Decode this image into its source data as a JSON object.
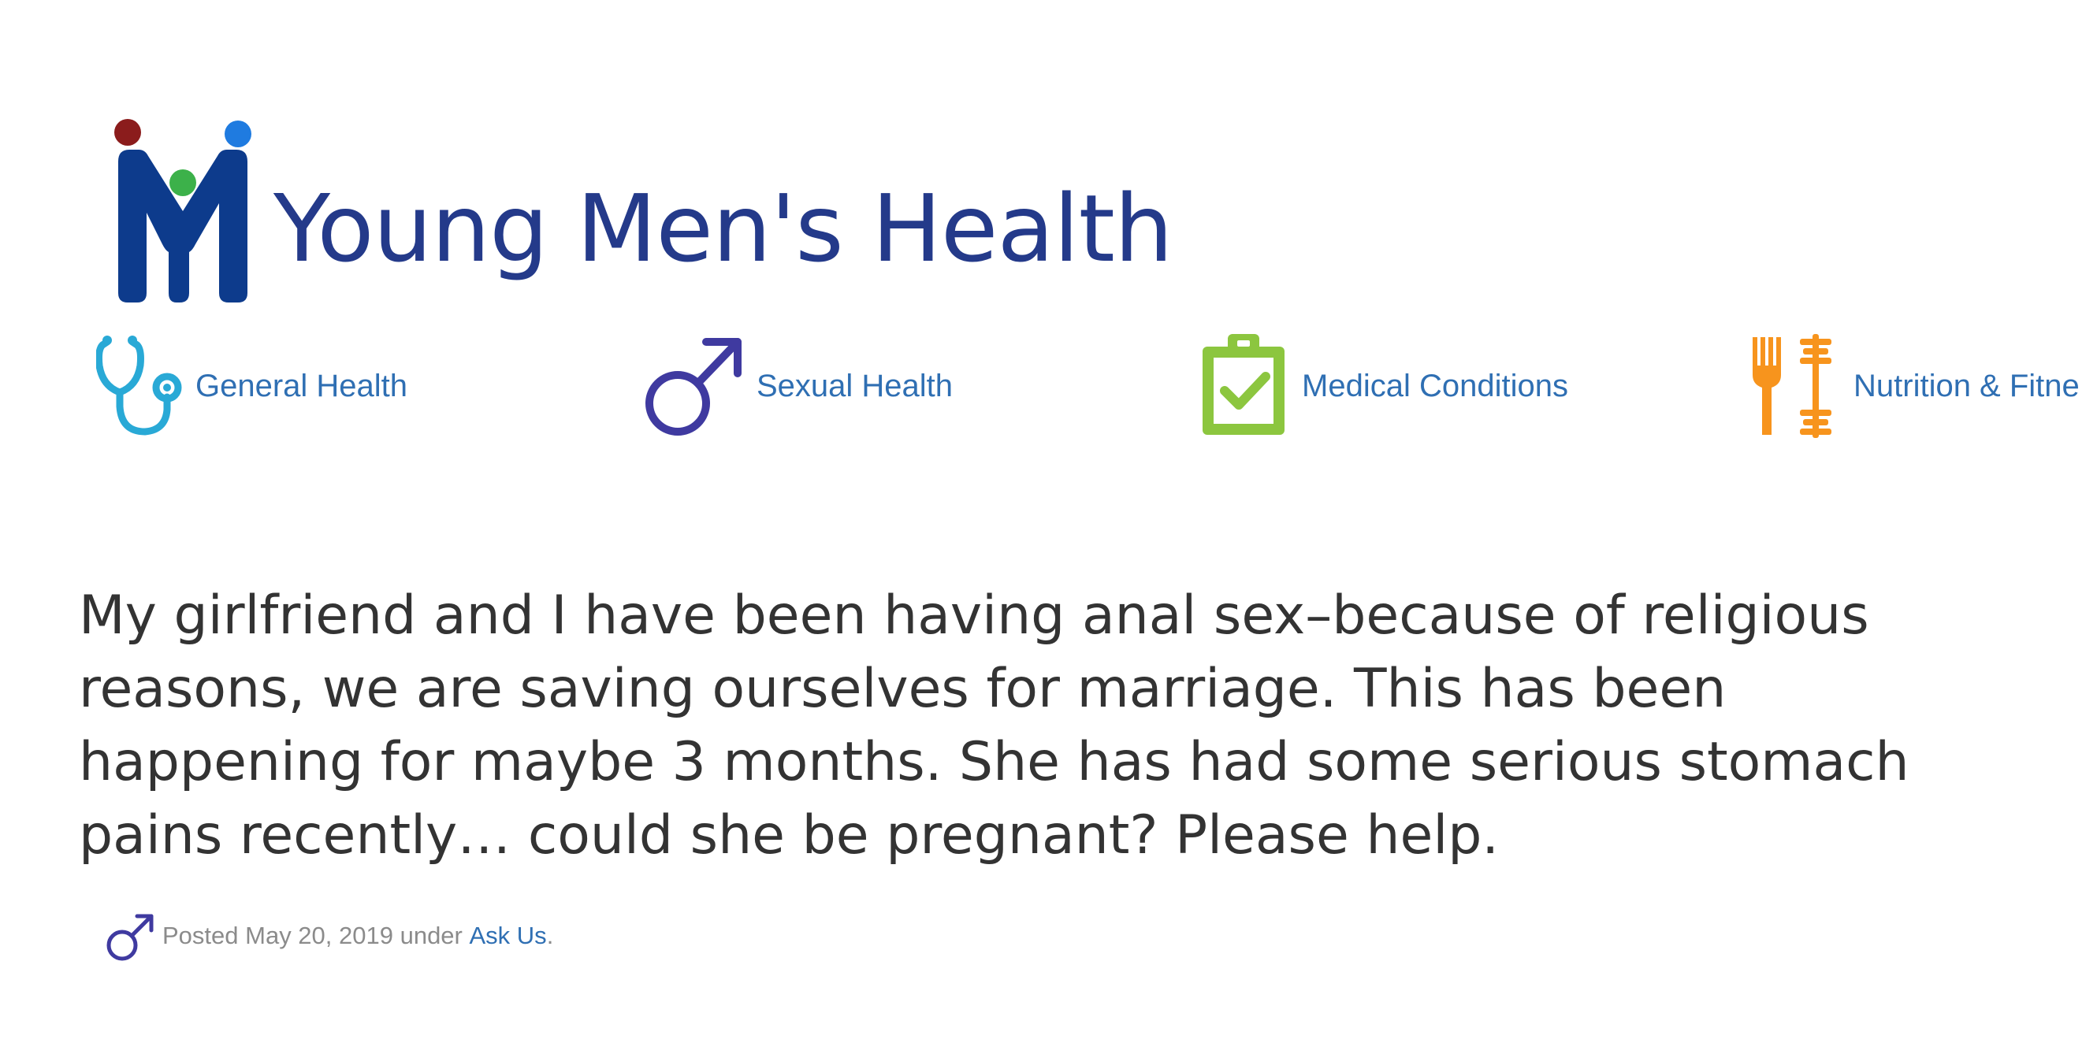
{
  "brand": {
    "name": "Young Men's Health",
    "colors": {
      "navy": "#0d3b8c",
      "dot_red": "#8b1c1c",
      "dot_green": "#3cb14a",
      "dot_blue": "#1f7be0",
      "title": "#243a8a"
    }
  },
  "nav": {
    "items": [
      {
        "label": "General Health",
        "icon": "stethoscope-icon",
        "color": "#29a9d6"
      },
      {
        "label": "Sexual Health",
        "icon": "male-symbol-icon",
        "color": "#3f3aa0"
      },
      {
        "label": "Medical Conditions",
        "icon": "clipboard-check-icon",
        "color": "#8cc63f"
      },
      {
        "label": "Nutrition & Fitne",
        "icon": "fork-dumbbell-icon",
        "color": "#f7941d"
      }
    ]
  },
  "question": {
    "text": "My girlfriend and I have been having anal sex–because of religious reasons, we are saving ourselves for marriage. This has been happening for maybe 3 months. She has had some serious stomach pains recently… could she be pregnant? Please help."
  },
  "meta": {
    "icon": "male-symbol-icon",
    "prefix": "Posted May 20, 2019 under ",
    "category_link": "Ask Us",
    "suffix": "."
  }
}
